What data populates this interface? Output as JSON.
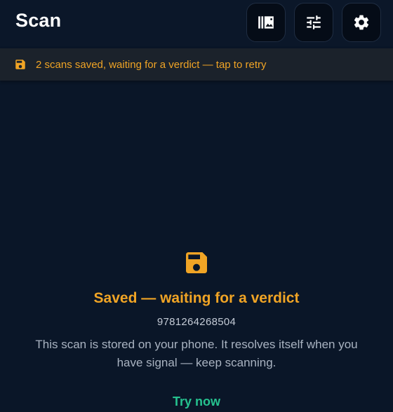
{
  "header": {
    "title": "Scan",
    "buttons": [
      {
        "icon": "library-icon"
      },
      {
        "icon": "tune-icon"
      },
      {
        "icon": "gear-icon"
      }
    ]
  },
  "banner": {
    "icon": "save-icon",
    "text": "2 scans saved, waiting for a verdict — tap to retry"
  },
  "status": {
    "icon": "save-icon",
    "title": "Saved — waiting for a verdict",
    "code": "9781264268504",
    "description": "This scan is stored on your phone. It resolves itself when you have signal — keep scanning.",
    "action_label": "Try now"
  },
  "colors": {
    "background": "#0a1628",
    "accent_warning": "#f0a425",
    "accent_action": "#26c28f",
    "text_primary": "#ffffff",
    "text_secondary": "#a9b3c1"
  }
}
